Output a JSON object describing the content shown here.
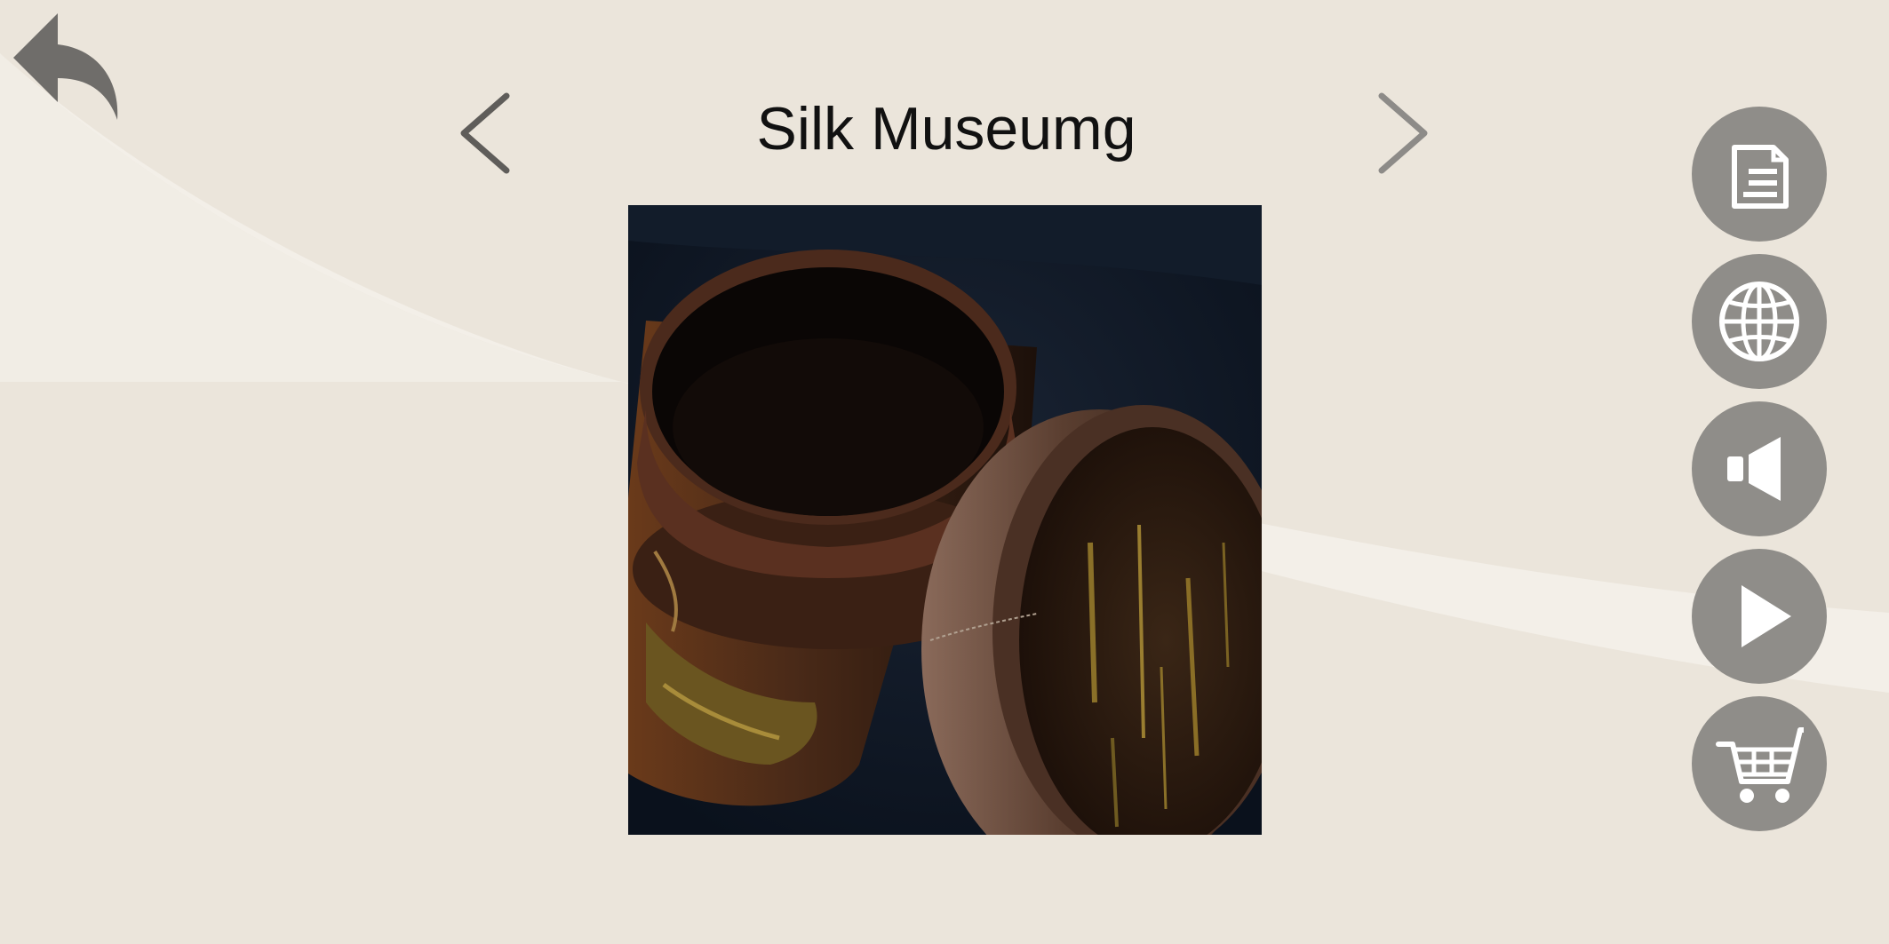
{
  "header": {
    "title": "Silk Museumg"
  },
  "icons": {
    "back": "back-arrow-icon",
    "prev": "chevron-left-icon",
    "next": "chevron-right-icon",
    "document": "document-icon",
    "globe": "globe-icon",
    "speaker": "speaker-icon",
    "play": "play-icon",
    "cart": "shopping-cart-icon"
  },
  "colors": {
    "background": "#ebe5db",
    "button": "#8f8d89",
    "icon_fill": "#ffffff",
    "back_arrow": "#6f6d6a",
    "prev_arrow": "#5f5d5a",
    "next_arrow": "#8d8b88"
  }
}
